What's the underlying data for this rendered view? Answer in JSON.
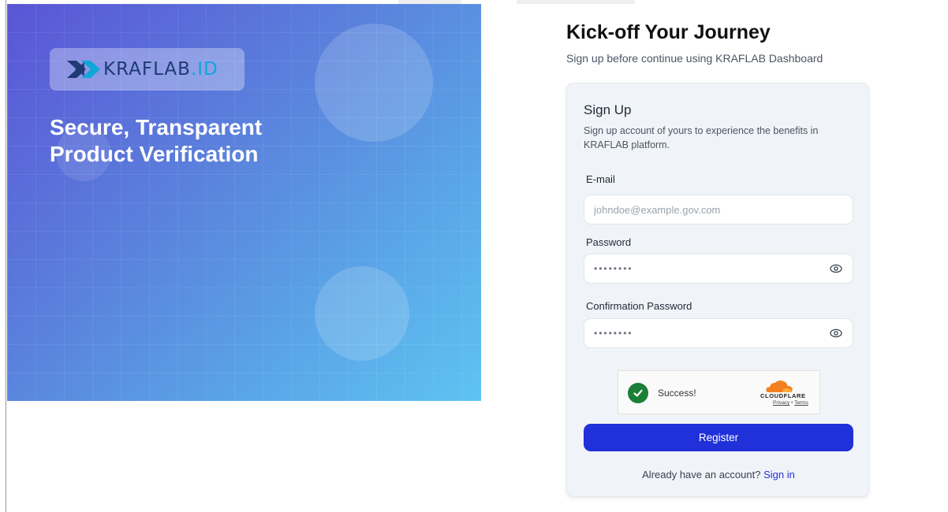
{
  "hero": {
    "logo_text": "KRAFLAB",
    "logo_suffix": ".ID",
    "title_line1": "Secure, Transparent",
    "title_line2": "Product Verification",
    "colors": {
      "gradient_start": "#5a55d6",
      "gradient_end": "#5ec3f2"
    }
  },
  "header": {
    "title": "Kick-off Your Journey",
    "subtitle": "Sign up before continue using KRAFLAB Dashboard"
  },
  "form": {
    "title": "Sign Up",
    "description": "Sign up account of yours to experience the benefits in KRAFLAB platform.",
    "email_label": "E-mail",
    "email_placeholder": "johndoe@example.gov.com",
    "password_label": "Password",
    "password_value": "••••••••",
    "confirm_label": "Confirmation Password",
    "confirm_value": "••••••••",
    "register_label": "Register",
    "signin_prompt": "Already have an account?",
    "signin_link": "Sign in"
  },
  "captcha": {
    "status": "Success!",
    "provider": "CLOUDFLARE",
    "privacy": "Privacy",
    "separator": "•",
    "terms": "Terms"
  },
  "icons": [
    "kraflab-logo-icon",
    "eye-icon",
    "check-icon",
    "cloudflare-cloud-icon"
  ],
  "colors": {
    "accent": "#2131d9",
    "success": "#1a7f37",
    "card_bg": "#f0f4f8"
  }
}
